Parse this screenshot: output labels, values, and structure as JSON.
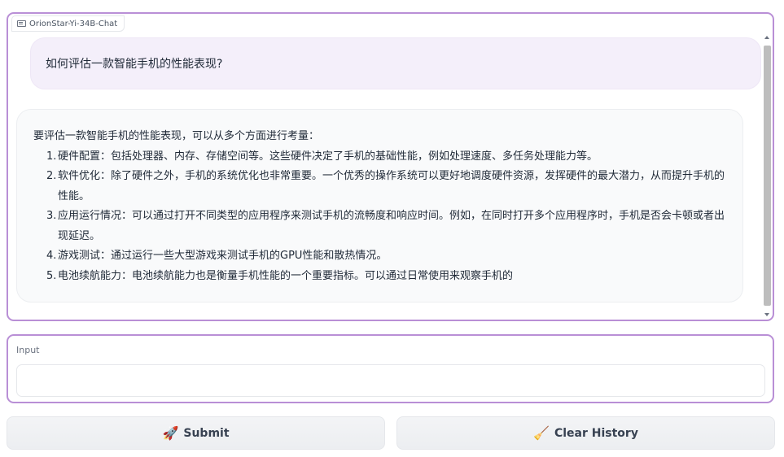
{
  "chatbot": {
    "label": "OrionStar-Yi-34B-Chat",
    "label_icon": "chat-icon",
    "messages": {
      "user": "如何评估一款智能手机的性能表现?",
      "bot_intro": "要评估一款智能手机的性能表现，可以从多个方面进行考量：",
      "bot_items": [
        {
          "num": "1.",
          "text": "硬件配置：包括处理器、内存、存储空间等。这些硬件决定了手机的基础性能，例如处理速度、多任务处理能力等。"
        },
        {
          "num": "2.",
          "text": "软件优化：除了硬件之外，手机的系统优化也非常重要。一个优秀的操作系统可以更好地调度硬件资源，发挥硬件的最大潜力，从而提升手机的性能。"
        },
        {
          "num": "3.",
          "text": "应用运行情况：可以通过打开不同类型的应用程序来测试手机的流畅度和响应时间。例如，在同时打开多个应用程序时，手机是否会卡顿或者出现延迟。"
        },
        {
          "num": "4.",
          "text": "游戏测试：通过运行一些大型游戏来测试手机的GPU性能和散热情况。"
        },
        {
          "num": "5.",
          "text": "电池续航能力：电池续航能力也是衡量手机性能的一个重要指标。可以通过日常使用来观察手机的"
        }
      ]
    }
  },
  "input": {
    "label": "Input",
    "value": "",
    "placeholder": ""
  },
  "buttons": {
    "submit": {
      "label": "Submit",
      "icon": "rocket-icon",
      "glyph": "🚀"
    },
    "clear": {
      "label": "Clear History",
      "icon": "broom-icon",
      "glyph": "🧹"
    }
  },
  "colors": {
    "panel_border": "#b98fd6",
    "user_bubble": "#f4effa",
    "bot_bubble": "#f9fafb",
    "button_bg": "#f3f4f6"
  }
}
